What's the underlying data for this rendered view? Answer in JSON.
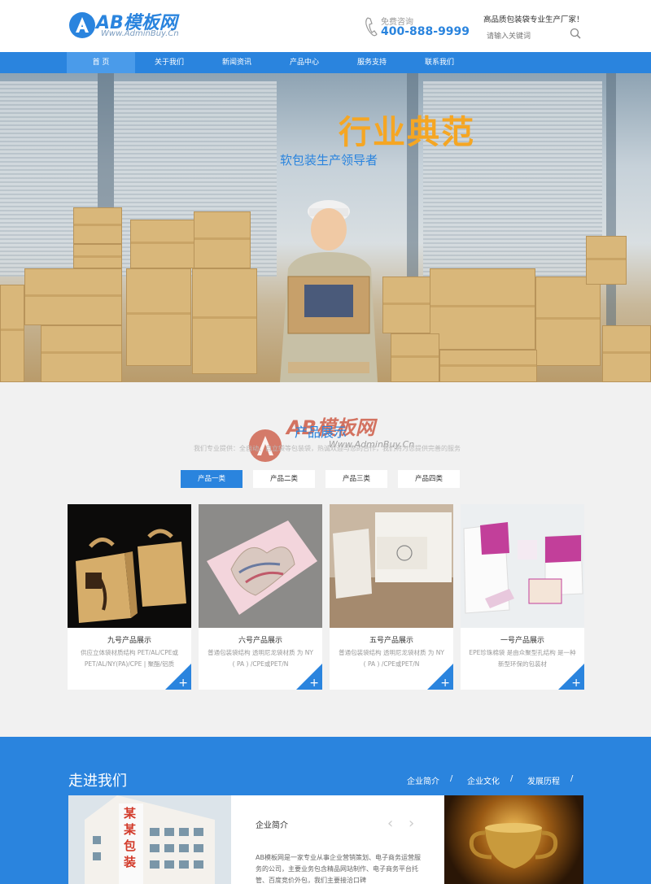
{
  "header": {
    "logo_text": "AB模板网",
    "logo_sub": "Www.AdminBuy.Cn",
    "hotline_label": "免费咨询",
    "hotline_number": "400-888-9999",
    "slogan": "高品质包装袋专业生产厂家！",
    "search_placeholder": "请输入关键词"
  },
  "nav": {
    "items": [
      {
        "label": "首 页",
        "active": true
      },
      {
        "label": "关于我们"
      },
      {
        "label": "新闻资讯"
      },
      {
        "label": "产品中心"
      },
      {
        "label": "服务支持"
      },
      {
        "label": "联系我们"
      }
    ]
  },
  "banner": {
    "title": "行业典范",
    "subtitle": "软包装生产领导者"
  },
  "products": {
    "title": "产品展示",
    "description": "我们专业提供：全自动、自立袋等包装袋，热诚欢迎与您的合作，我们将为您提供完善的服务",
    "watermark": "AB模板网",
    "watermark_sub": "Www.AdminBuy.Cn",
    "tabs": [
      {
        "label": "产品一类",
        "active": true
      },
      {
        "label": "产品二类"
      },
      {
        "label": "产品三类"
      },
      {
        "label": "产品四类"
      }
    ],
    "cards": [
      {
        "title": "九号产品展示",
        "desc": "供应立体袋材质结构 PET/AL/CPE或 PET/AL/NY(PA)/CPE | 聚酯/铝质"
      },
      {
        "title": "六号产品展示",
        "desc": "普通包装袋结构 透明尼龙袋材质 为 NY ( PA ) /CPE或PET/N"
      },
      {
        "title": "五号产品展示",
        "desc": "普通包装袋结构 透明尼龙袋材质 为 NY ( PA ) /CPE或PET/N"
      },
      {
        "title": "一号产品展示",
        "desc": "EPE珍珠棉袋 是由众聚型孔结构 是一种 新型环保的包装材"
      }
    ]
  },
  "about": {
    "title": "走进我们",
    "links": [
      "企业简介",
      "企业文化",
      "发展历程"
    ],
    "panel_title": "企业简介",
    "panel_body": "AB模板网是一家专业从事企业营销策划、电子商务运营服务的公司，主要业务包含精品网站制作、电子商务平台托管、百度竞价外包，我们主要接洽口碑",
    "building_sign": "某某包装"
  },
  "colors": {
    "brand": "#2a84de",
    "accent": "#f5a623"
  }
}
